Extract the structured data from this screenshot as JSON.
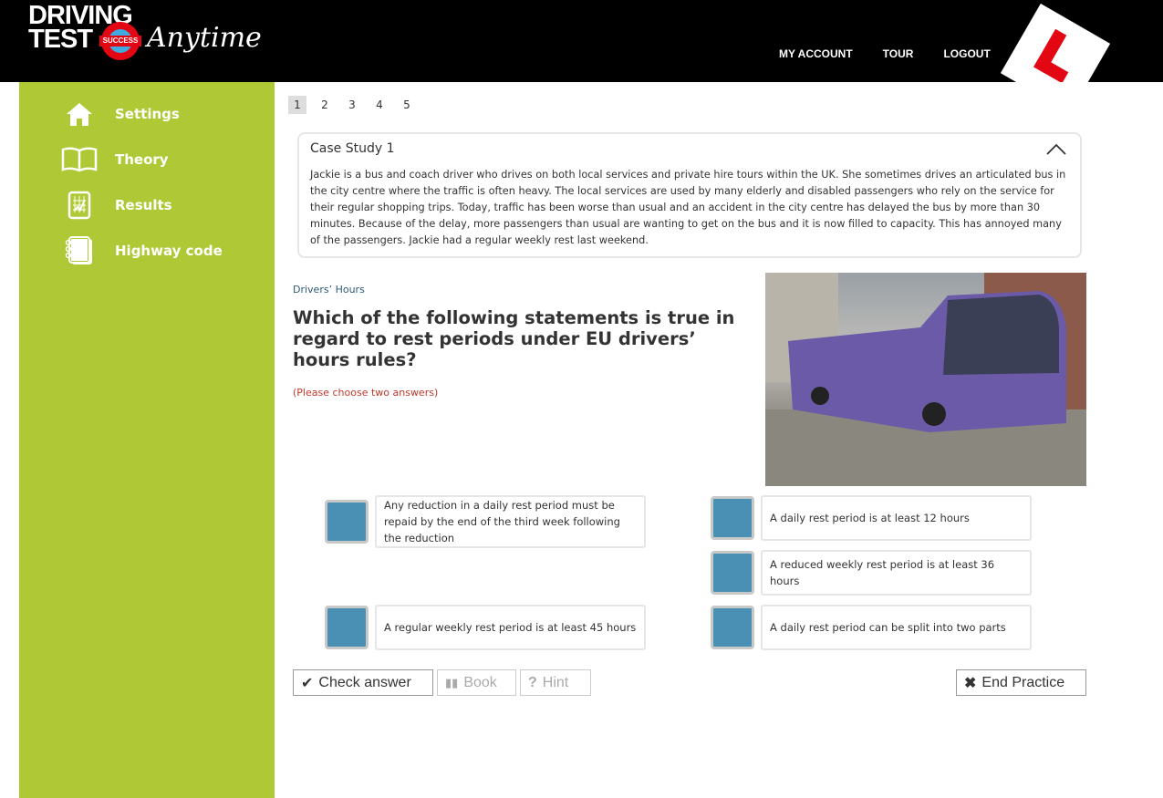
{
  "header": {
    "logo": {
      "line1": "DRIVING",
      "line2": "TEST",
      "badge": "SUCCESS",
      "script": "Anytime"
    },
    "nav": [
      "MY ACCOUNT",
      "TOUR",
      "LOGOUT"
    ]
  },
  "sidebar": {
    "items": [
      {
        "label": "Settings",
        "icon": "home-icon"
      },
      {
        "label": "Theory",
        "icon": "book-icon"
      },
      {
        "label": "Results",
        "icon": "chart-icon"
      },
      {
        "label": "Highway code",
        "icon": "notebook-icon"
      }
    ]
  },
  "pager": {
    "pages": [
      "1",
      "2",
      "3",
      "4",
      "5"
    ],
    "current": "1"
  },
  "case_study": {
    "title": "Case Study 1",
    "text": "Jackie is a bus and coach driver who drives on both local services and private hire tours within the UK. She sometimes drives an articulated bus in the city centre where the traffic is often heavy. The local services are used by many elderly and disabled passengers who rely on the service for their regular shopping trips. Today, traffic has been worse than usual and an accident in the city centre has delayed the bus by more than 30 minutes. Because of the delay, more passengers than usual are wanting to get on the bus and it is now filled to capacity. This has annoyed many of the passengers. Jackie had a regular weekly rest last weekend."
  },
  "question": {
    "category": "Drivers’ Hours",
    "text": "Which of the following statements is true in regard to rest periods under EU drivers’ hours rules?",
    "instruction": "(Please choose two answers)"
  },
  "answers": [
    "Any reduction in a daily rest period must be repaid by the end of the third week following the reduction",
    "A daily rest period is at least 12 hours",
    "A reduced weekly rest period is at least 36 hours",
    "A regular weekly rest period is at least 45 hours",
    "A daily rest period can be split into two parts"
  ],
  "buttons": {
    "check": "Check answer",
    "book": "Book",
    "hint": "Hint",
    "end": "End Practice"
  },
  "colors": {
    "sidebar": "#afc936",
    "checkbox": "#4a90b4",
    "header": "#000000",
    "instruction": "#c0392b"
  }
}
